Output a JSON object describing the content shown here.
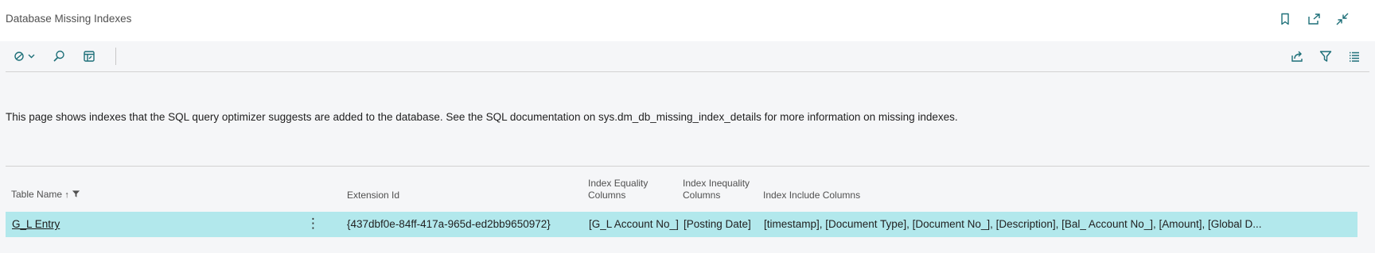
{
  "window": {
    "title": "Database Missing Indexes",
    "icons": [
      "bookmark-icon",
      "open-in-new-window-icon",
      "collapse-icon"
    ]
  },
  "toolbar": {
    "left_icons": [
      "copilot-menu-icon",
      "search-icon",
      "edit-list-icon"
    ],
    "right_icons": [
      "share-icon",
      "filter-icon",
      "list-view-icon"
    ]
  },
  "description": "This page shows indexes that the SQL query optimizer suggests are added to the database. See the SQL documentation on sys.dm_db_missing_index_details for more information on missing indexes.",
  "table": {
    "columns": {
      "table_name": "Table Name",
      "extension_id": "Extension Id",
      "index_equality_1": "Index Equality",
      "index_equality_2": "Columns",
      "index_inequality_1": "Index Inequality",
      "index_inequality_2": "Columns",
      "index_include": "Index Include Columns"
    },
    "rows": [
      {
        "table_name": "G_L Entry",
        "extension_id": "{437dbf0e-84ff-417a-965d-ed2bb9650972}",
        "index_equality": "[G_L Account No_]",
        "index_inequality": "[Posting Date]",
        "index_include": "[timestamp], [Document Type], [Document No_], [Description], [Bal_ Account No_], [Amount], [Global D..."
      }
    ]
  },
  "colors": {
    "row_selected": "#b2e8ec",
    "accent": "#1d6f78"
  }
}
